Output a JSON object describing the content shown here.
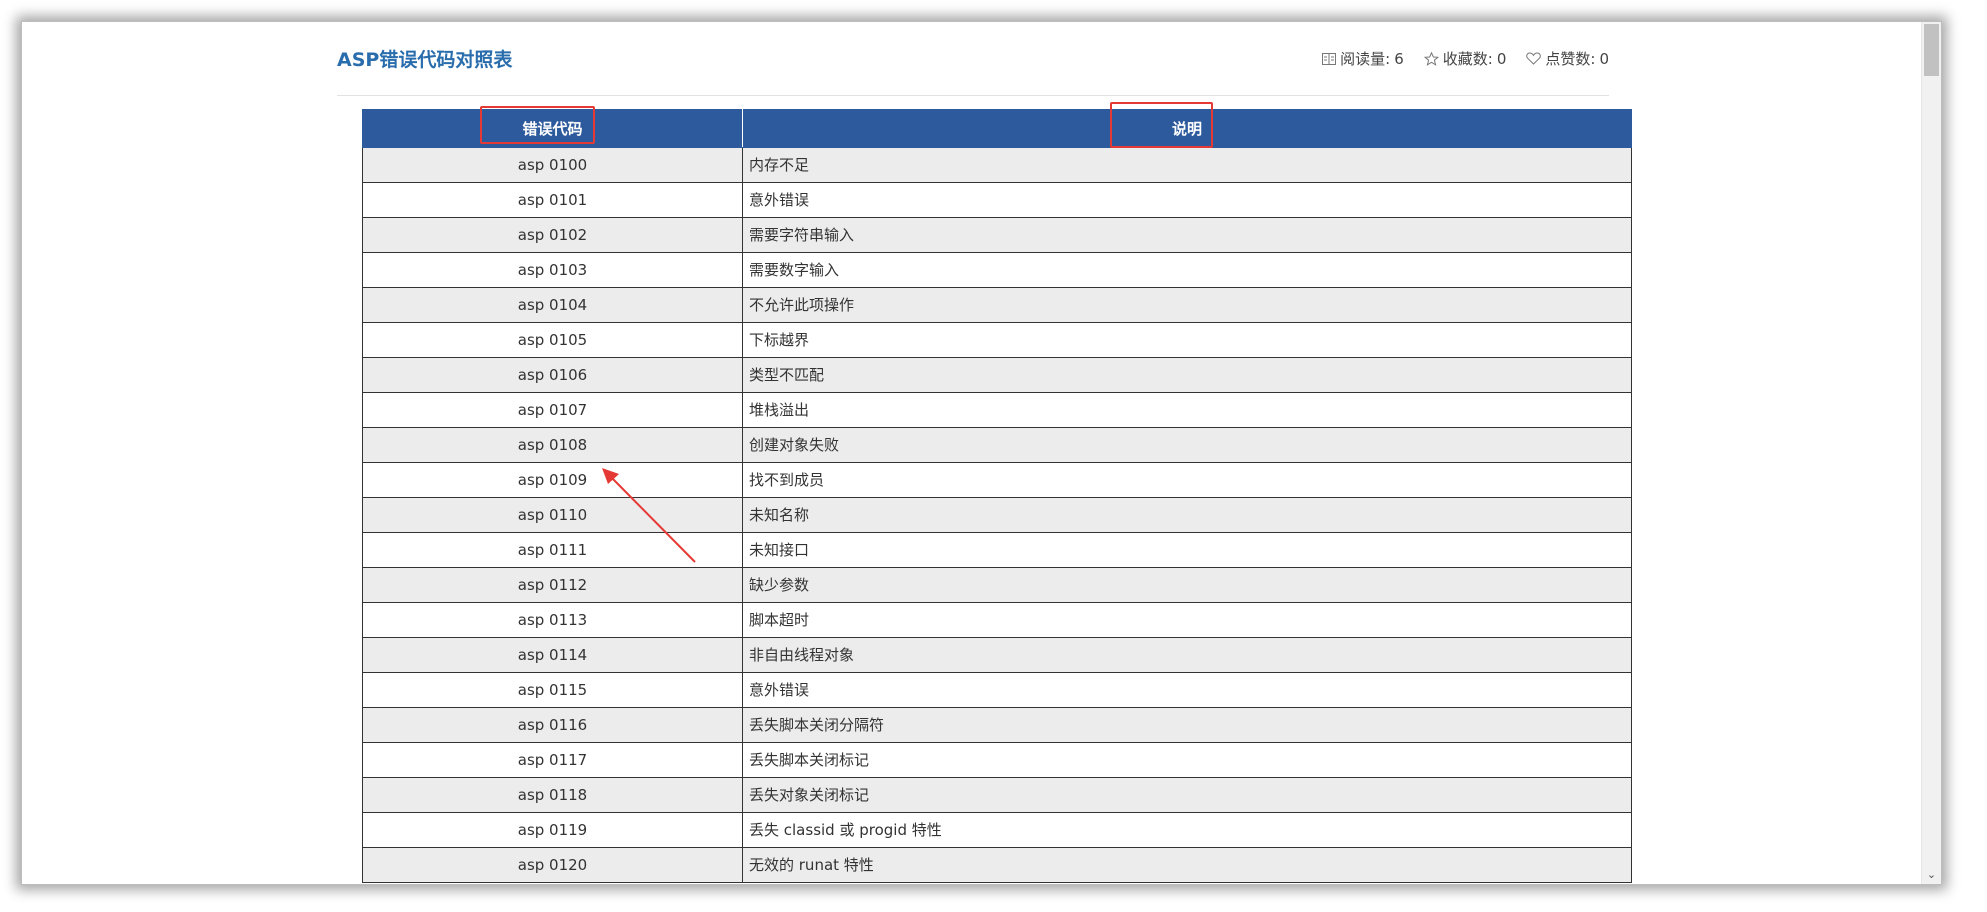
{
  "article": {
    "title": "ASP错误代码对照表",
    "stats": {
      "reads_label": "阅读量:",
      "reads_value": "6",
      "favorites_label": "收藏数:",
      "favorites_value": "0",
      "likes_label": "点赞数:",
      "likes_value": "0"
    }
  },
  "table": {
    "headers": [
      "错误代码",
      "说明"
    ],
    "rows": [
      [
        "asp 0100",
        "内存不足"
      ],
      [
        "asp 0101",
        "意外错误"
      ],
      [
        "asp 0102",
        "需要字符串输入"
      ],
      [
        "asp 0103",
        "需要数字输入"
      ],
      [
        "asp 0104",
        "不允许此项操作"
      ],
      [
        "asp 0105",
        "下标越界"
      ],
      [
        "asp 0106",
        "类型不匹配"
      ],
      [
        "asp 0107",
        "堆栈溢出"
      ],
      [
        "asp 0108",
        "创建对象失败"
      ],
      [
        "asp 0109",
        "找不到成员"
      ],
      [
        "asp 0110",
        "未知名称"
      ],
      [
        "asp 0111",
        "未知接口"
      ],
      [
        "asp 0112",
        "缺少参数"
      ],
      [
        "asp 0113",
        "脚本超时"
      ],
      [
        "asp 0114",
        "非自由线程对象"
      ],
      [
        "asp 0115",
        "意外错误"
      ],
      [
        "asp 0116",
        "丢失脚本关闭分隔符"
      ],
      [
        "asp 0117",
        "丢失脚本关闭标记"
      ],
      [
        "asp 0118",
        "丢失对象关闭标记"
      ],
      [
        "asp 0119",
        "丢失 classid 或 progid 特性"
      ],
      [
        "asp 0120",
        "无效的 runat 特性"
      ]
    ]
  },
  "annotations": {
    "highlight_color": "#e53935"
  },
  "colors": {
    "title": "#2a6dad",
    "header_bg": "#2d5a9c",
    "row_alt": "#ececec"
  },
  "icons": {
    "reads": "book-icon",
    "favorites": "star-icon",
    "likes": "heart-icon"
  }
}
